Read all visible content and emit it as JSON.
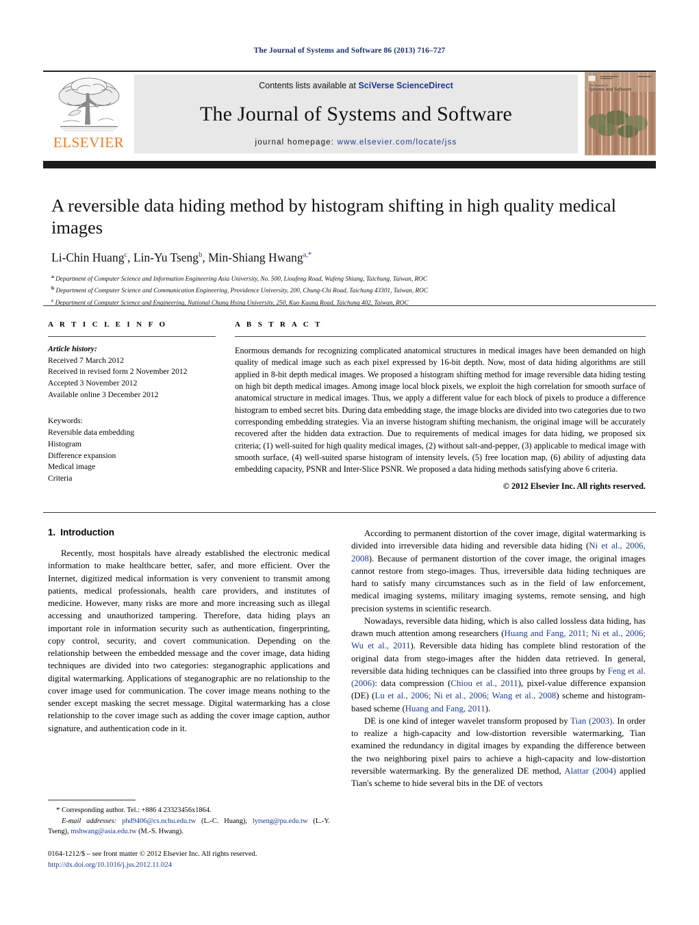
{
  "running_head": "The Journal of Systems and Software 86 (2013) 716–727",
  "masthead": {
    "publisher_name": "ELSEVIER",
    "contents_prefix": "Contents lists available at ",
    "contents_link": "SciVerse ScienceDirect",
    "journal_title": "The Journal of Systems and Software",
    "homepage_prefix": "journal homepage: ",
    "homepage_url": "www.elsevier.com/locate/jss",
    "cover_title_small": "The Journal of",
    "cover_title_main": "Systems and Software"
  },
  "article": {
    "title": "A reversible data hiding method by histogram shifting in high quality medical images",
    "authors_html": "Li-Chin Huang<sup>c</sup>, Lin-Yu Tseng<sup>b</sup>, Min-Shiang Hwang<sup>a,</sup><sup>*</sup>",
    "affiliations": [
      "Department of Computer Science and Information Engineering Asia University, No. 500, Lioufeng Road, Wufeng Shiang, Taichung, Taiwan, ROC",
      "Department of Computer Science and Communication Engineering, Providence University, 200, Chung-Chi Road, Taichung 43301, Taiwan, ROC",
      "Department of Computer Science and Engineering, National Chung Hsing University, 250, Kuo Kuang Road, Taichung 402, Taiwan, ROC"
    ],
    "affiliation_marks": [
      "a",
      "b",
      "c"
    ]
  },
  "article_info": {
    "heading": "A R T I C L E   I N F O",
    "history_label": "Article history:",
    "history": [
      "Received 7 March 2012",
      "Received in revised form 2 November 2012",
      "Accepted 3 November 2012",
      "Available online 3 December 2012"
    ],
    "keywords_label": "Keywords:",
    "keywords": [
      "Reversible data embedding",
      "Histogram",
      "Difference expansion",
      "Medical image",
      "Criteria"
    ]
  },
  "abstract": {
    "heading": "A B S T R A C T",
    "text": "Enormous demands for recognizing complicated anatomical structures in medical images have been demanded on high quality of medical image such as each pixel expressed by 16-bit depth. Now, most of data hiding algorithms are still applied in 8-bit depth medical images. We proposed a histogram shifting method for image reversible data hiding testing on high bit depth medical images. Among image local block pixels, we exploit the high correlation for smooth surface of anatomical structure in medical images. Thus, we apply a different value for each block of pixels to produce a difference histogram to embed secret bits. During data embedding stage, the image blocks are divided into two categories due to two corresponding embedding strategies. Via an inverse histogram shifting mechanism, the original image will be accurately recovered after the hidden data extraction. Due to requirements of medical images for data hiding, we proposed six criteria; (1) well-suited for high quality medical images, (2) without salt-and-pepper, (3) applicable to medical image with smooth surface, (4) well-suited sparse histogram of intensity levels, (5) free location map, (6) ability of adjusting data embedding capacity, PSNR and Inter-Slice PSNR. We proposed a data hiding methods satisfying above 6 criteria.",
    "copyright": "© 2012 Elsevier Inc. All rights reserved."
  },
  "body": {
    "section_number": "1.",
    "section_title": "Introduction",
    "left_paragraphs": [
      "Recently, most hospitals have already established the electronic medical information to make healthcare better, safer, and more efficient. Over the Internet, digitized medical information is very convenient to transmit among patients, medical professionals, health care providers, and institutes of medicine. However, many risks are more and more increasing such as illegal accessing and unauthorized tampering. Therefore, data hiding plays an important role in information security such as authentication, fingerprinting, copy control, security, and covert communication. Depending on the relationship between the embedded message and the cover image, data hiding techniques are divided into two categories: steganographic applications and digital watermarking. Applications of steganographic are no relationship to the cover image used for communication. The cover image means nothing to the sender except masking the secret message. Digital watermarking has a close relationship to the cover image such as adding the cover image caption, author signature, and authentication code in it."
    ],
    "right_paragraphs_html": [
      "According to permanent distortion of the cover image, digital watermarking is divided into irreversible data hiding and reversible data hiding (<span class=\"ref\">Ni et al., 2006, 2008</span>). Because of permanent distortion of the cover image, the original images cannot restore from stego-images. Thus, irreversible data hiding techniques are hard to satisfy many circumstances such as in the field of law enforcement, medical imaging systems, military imaging systems, remote sensing, and high precision systems in scientific research.",
      "Nowadays, reversible data hiding, which is also called lossless data hiding, has drawn much attention among researchers (<span class=\"ref\">Huang and Fang, 2011; Ni et al., 2006; Wu et al., 2011</span>). Reversible data hiding has complete blind restoration of the original data from stego-images after the hidden data retrieved. In general, reversible data hiding techniques can be classified into three groups by <span class=\"ref\">Feng et al. (2006)</span>: data compression (<span class=\"ref\">Chiou et al., 2011</span>), pixel-value difference expansion (DE) (<span class=\"ref\">Lu et al., 2006; Ni et al., 2006; Wang et al., 2008</span>) scheme and histogram-based scheme (<span class=\"ref\">Huang and Fang, 2011</span>).",
      "DE is one kind of integer wavelet transform proposed by <span class=\"ref\">Tian (2003)</span>. In order to realize a high-capacity and low-distortion reversible watermarking, Tian examined the redundancy in digital images by expanding the difference between the two neighboring pixel pairs to achieve a high-capacity and low-distortion reversible watermarking. By the generalized DE method, <span class=\"ref\">Alattar (2004)</span> applied Tian's scheme to hide several bits in the DE of vectors"
    ]
  },
  "footnotes": {
    "corresponding_html": "<span style=\"font-size:11px\">*</span> Corresponding author. Tel.: +886 4 23323456x1864.",
    "email_html": "<span class=\"em\">E-mail addresses:</span> <span class=\"mail\">phd9406@cs.nchu.edu.tw</span> (L.-C. Huang), <span class=\"mail\">lytseng@pu.edu.tw</span> (L.-Y. Tseng), <span class=\"mail\">mshwang@asia.edu.tw</span> (M.-S. Hwang).",
    "issn_line": "0164-1212/$ – see front matter © 2012 Elsevier Inc. All rights reserved.",
    "doi_line": "http://dx.doi.org/10.1016/j.jss.2012.11.024"
  },
  "colors": {
    "running_head": "#1a2f6b",
    "link": "#1a3a8f",
    "elsevier_orange": "#ef7c22",
    "masthead_bg": "#e8e8e8",
    "black_bar": "#1c1c1c"
  }
}
